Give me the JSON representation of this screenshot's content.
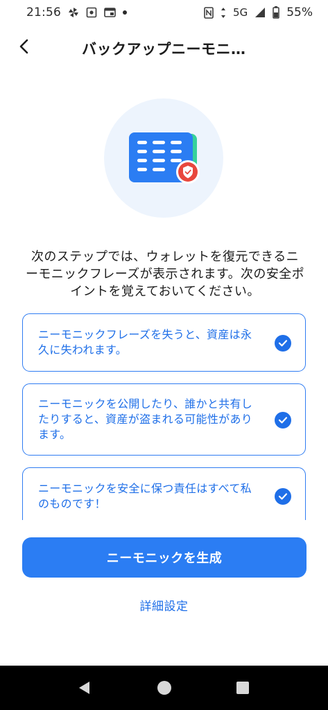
{
  "status_bar": {
    "time": "21:56",
    "network": "5G",
    "battery": "55%"
  },
  "header": {
    "title": "バックアップニーモニ…"
  },
  "intro": {
    "text": "次のステップでは、ウォレットを復元できるニーモニックフレーズが表示されます。次の安全ポイントを覚えておいてください。"
  },
  "warnings": [
    {
      "text": "ニーモニックフレーズを失うと、資産は永久に失われます。",
      "checked": true
    },
    {
      "text": "ニーモニックを公開したり、誰かと共有したりすると、資産が盗まれる可能性があります。",
      "checked": true
    },
    {
      "text": "ニーモニックを安全に保つ責任はすべて私のものです！",
      "checked": true
    }
  ],
  "actions": {
    "primary_label": "ニーモニックを生成",
    "secondary_label": "詳細設定"
  },
  "colors": {
    "accent": "#2b7df3",
    "card_border": "#2f7cf2",
    "illustration_bg": "#edf4fd",
    "shield": "#e8473d"
  },
  "icons": {
    "back": "chevron-left-icon",
    "check": "check-circle-icon",
    "illustration": "mnemonic-card-shield-icon"
  }
}
